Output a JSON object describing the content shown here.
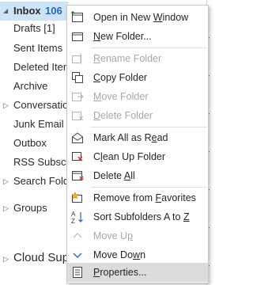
{
  "folders": {
    "inbox": {
      "label": "Inbox",
      "count": "106"
    },
    "drafts": "Drafts [1]",
    "sent": "Sent Items",
    "deleted": "Deleted Items",
    "archive": "Archive",
    "conversation": "Conversation History",
    "junk": "Junk Email",
    "outbox": "Outbox",
    "rss": "RSS Subscriptions",
    "search": "Search Folders",
    "groups": "Groups",
    "cloud": "Cloud Support"
  },
  "menu": {
    "open_new_window": {
      "pre": "Open in New ",
      "u": "W",
      "post": "indow"
    },
    "new_folder": {
      "pre": "",
      "u": "N",
      "post": "ew Folder..."
    },
    "rename_folder": {
      "pre": "",
      "u": "R",
      "post": "ename Folder"
    },
    "copy_folder": {
      "pre": "",
      "u": "C",
      "post": "opy Folder"
    },
    "move_folder": {
      "pre": "",
      "u": "M",
      "post": "ove Folder"
    },
    "delete_folder": {
      "pre": "",
      "u": "D",
      "post": "elete Folder"
    },
    "mark_all_read": {
      "pre": "Mark All as R",
      "u": "e",
      "post": "ad"
    },
    "clean_up_folder": {
      "pre": "C",
      "u": "l",
      "post": "ean Up Folder"
    },
    "delete_all": {
      "pre": "Delete ",
      "u": "A",
      "post": "ll"
    },
    "remove_favorites": {
      "pre": "Remove from ",
      "u": "F",
      "post": "avorites"
    },
    "sort_subfolders": {
      "pre": "Sort Subfolders A to ",
      "u": "Z",
      "post": ""
    },
    "move_up": {
      "pre": "Move U",
      "u": "p",
      "post": ""
    },
    "move_down": {
      "pre": "Move Do",
      "u": "w",
      "post": "n"
    },
    "properties": {
      "pre": "",
      "u": "P",
      "post": "roperties..."
    }
  },
  "colors": {
    "accent": "#1f6bc4",
    "selected_bg": "#cde3f7",
    "hover_bg": "#dcdcdc",
    "disabled": "#a8a8a8"
  }
}
